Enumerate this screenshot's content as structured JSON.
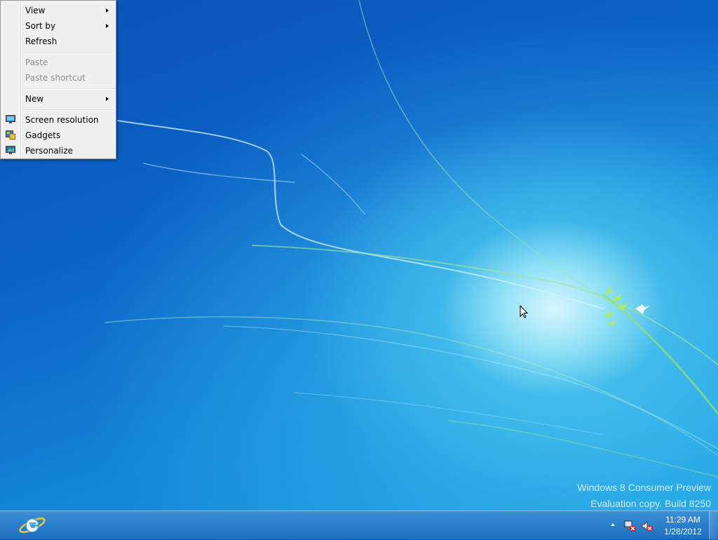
{
  "menu": {
    "items": [
      {
        "label": "View",
        "state": "enabled",
        "submenu": true
      },
      {
        "label": "Sort by",
        "state": "enabled",
        "submenu": true
      },
      {
        "label": "Refresh",
        "state": "enabled"
      },
      {
        "label": "Paste",
        "state": "disabled"
      },
      {
        "label": "Paste shortcut",
        "state": "disabled"
      },
      {
        "label": "New",
        "state": "enabled",
        "submenu": true
      },
      {
        "label": "Screen resolution",
        "icon": "monitor-icon"
      },
      {
        "label": "Gadgets",
        "icon": "gadgets-icon"
      },
      {
        "label": "Personalize",
        "icon": "personalize-icon"
      }
    ]
  },
  "watermark": {
    "line1": "Windows 8 Consumer Preview",
    "line2": "Evaluation copy. Build 8250"
  },
  "taskbar": {
    "pinned": [
      {
        "icon": "internet-explorer-icon"
      }
    ],
    "tray_icons": [
      "show-hidden-icons-arrow",
      "network-error-icon",
      "volume-muted-icon"
    ]
  },
  "clock": {
    "time": "11:29 AM",
    "date": "1/28/2012"
  },
  "colors": {
    "menu_background": "#f0f0f0",
    "taskbar": "#2a7fcb",
    "desktop": "#0c62c6",
    "disabled_text": "#8d8d8d"
  }
}
